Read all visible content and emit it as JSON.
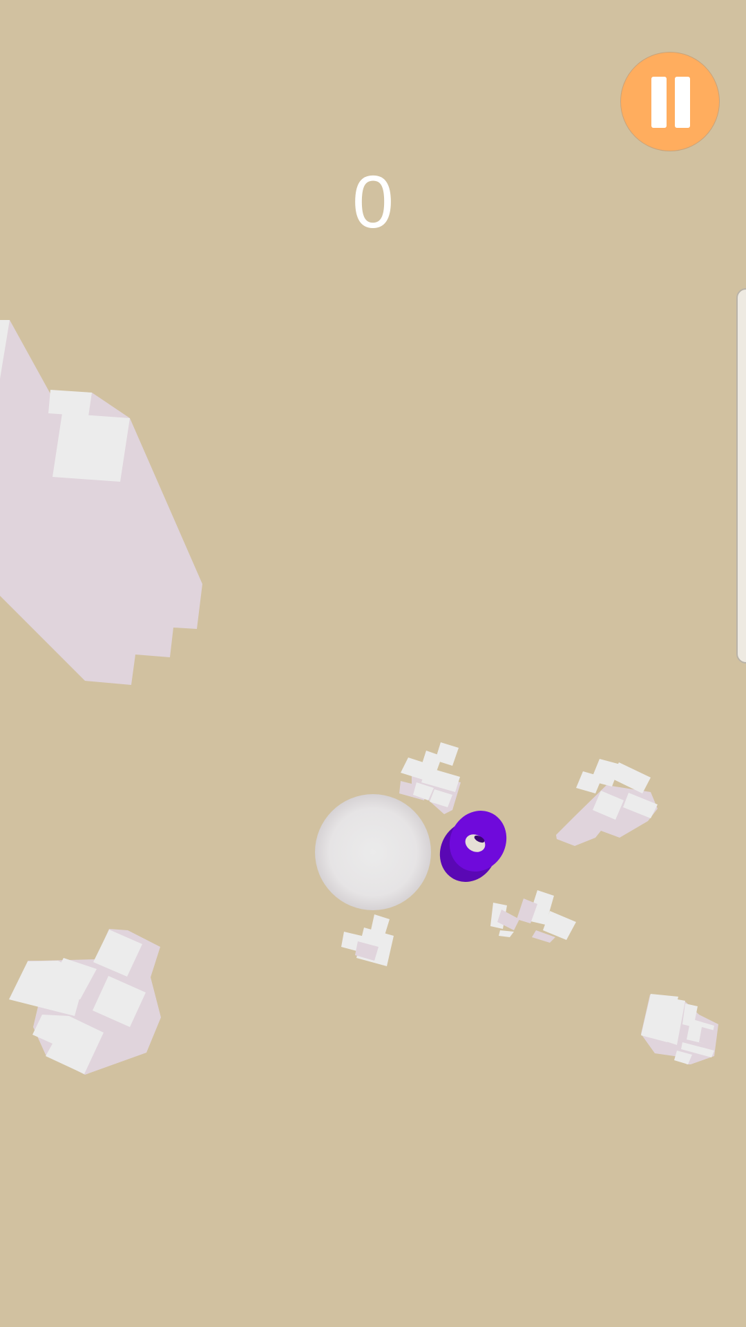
{
  "score": {
    "value": "0"
  },
  "pause_button": {
    "icon": "pause-icon",
    "label": "Pause"
  },
  "colors": {
    "background": "#d1c1a0",
    "pause_button_fill": "#ffad5e",
    "score_text": "#ffffff",
    "player_ball": "#e6e3e3",
    "ring": "#6f0adb",
    "cube_top": "#ececec",
    "cube_shadow": "#e0d4dc"
  },
  "scene": {
    "ball": {
      "name": "player-ball"
    },
    "ring": {
      "name": "purple-ring"
    },
    "rocks": [
      {
        "name": "large-rock-left"
      },
      {
        "name": "rock-cluster-upper-middle"
      },
      {
        "name": "rock-cluster-upper-right"
      },
      {
        "name": "rock-cluster-lower-middle"
      },
      {
        "name": "rock-cluster-small-middle"
      },
      {
        "name": "rock-cluster-lower-left"
      },
      {
        "name": "rock-cluster-lower-right"
      }
    ]
  }
}
